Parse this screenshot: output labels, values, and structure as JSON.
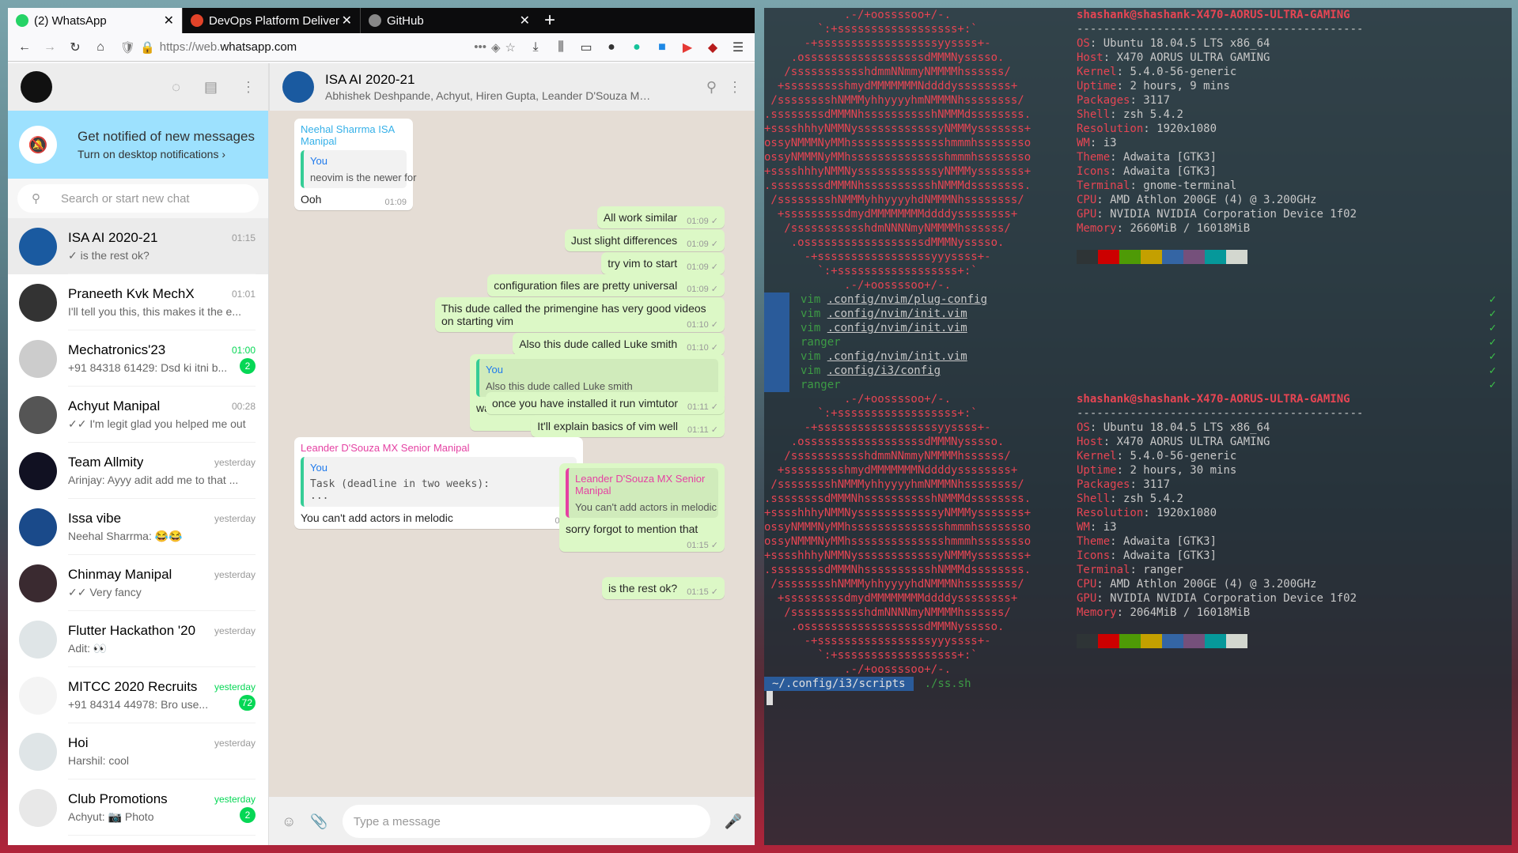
{
  "browser": {
    "tabs": [
      {
        "label": "(2) WhatsApp",
        "color": "#25d366"
      },
      {
        "label": "DevOps Platform Deliver",
        "color": "#e24329"
      },
      {
        "label": "GitHub",
        "color": "#888888"
      }
    ],
    "url_prefix": "https://web.",
    "url_domain": "whatsapp.com"
  },
  "whatsapp": {
    "notif_title": "Get notified of new messages",
    "notif_sub": "Turn on desktop notifications ›",
    "search_placeholder": "Search or start new chat",
    "chats": [
      {
        "name": "ISA AI 2020-21",
        "time": "01:15",
        "preview": "✓ is the rest ok?",
        "badge": "",
        "color": "#1a5aa0"
      },
      {
        "name": "Praneeth Kvk MechX",
        "time": "01:01",
        "preview": "I'll tell you this, this makes it the e...",
        "badge": "",
        "color": "#333333"
      },
      {
        "name": "Mechatronics'23",
        "time": "01:00",
        "preview": "+91 84318 61429: Dsd ki itni b...",
        "badge": "2",
        "color": "#cccccc"
      },
      {
        "name": "Achyut Manipal",
        "time": "00:28",
        "preview": "✓✓ I'm legit glad you helped me out",
        "badge": "",
        "color": "#555555"
      },
      {
        "name": "Team Allmity",
        "time": "yesterday",
        "preview": "Arinjay: Ayyy adit add me to that ...",
        "badge": "",
        "color": "#111122"
      },
      {
        "name": "Issa vibe",
        "time": "yesterday",
        "preview": "Neehal Sharrma: 😂😂",
        "badge": "",
        "color": "#1a4a8a"
      },
      {
        "name": "Chinmay Manipal",
        "time": "yesterday",
        "preview": "✓✓ Very fancy",
        "badge": "",
        "color": "#3a2a30"
      },
      {
        "name": "Flutter Hackathon '20",
        "time": "yesterday",
        "preview": "Adit: 👀",
        "badge": "",
        "color": "#dfe5e7"
      },
      {
        "name": "MITCC 2020 Recruits",
        "time": "yesterday",
        "preview": "+91 84314 44978: Bro use...",
        "badge": "72",
        "color": "#f4f4f4"
      },
      {
        "name": "Hoi",
        "time": "yesterday",
        "preview": "Harshil: cool",
        "badge": "",
        "color": "#dfe5e7"
      },
      {
        "name": "Club Promotions",
        "time": "yesterday",
        "preview": "Achyut: 📷 Photo",
        "badge": "2",
        "color": "#e8e8e8"
      }
    ],
    "group_name": "ISA AI 2020-21",
    "group_members": "Abhishek Deshpande, Achyut, Hiren Gupta, Leander D'Souza MX, Mi...",
    "compose_placeholder": "Type a message",
    "messages": [
      {
        "dir": "in",
        "sender": "Neehal Sharrma ISA Manipal",
        "quote_author": "You",
        "quote": "neovim is the newer for",
        "text": "Ooh",
        "time": "01:09"
      },
      {
        "dir": "out",
        "text": "All work similar",
        "time": "01:09 ✓"
      },
      {
        "dir": "out",
        "text": "Just slight differences",
        "time": "01:09 ✓"
      },
      {
        "dir": "out",
        "text": "try vim to start",
        "time": "01:09 ✓"
      },
      {
        "dir": "out",
        "text": "configuration files are pretty universal",
        "time": "01:09 ✓"
      },
      {
        "dir": "out",
        "text": "This dude called the primengine has very good videos on starting vim",
        "time": "01:10 ✓"
      },
      {
        "dir": "out",
        "text": "Also this dude called Luke smith",
        "time": "01:10 ✓"
      },
      {
        "dir": "out",
        "quote_author": "You",
        "quote": "Also this dude called Luke smith",
        "text": "watch his vimtutor playthrough for a crash course",
        "time": "01:10 ✓"
      },
      {
        "dir": "out",
        "text": "once you have installed it run vimtutor",
        "time": "01:11 ✓"
      },
      {
        "dir": "out",
        "text": "It'll explain basics of vim well",
        "time": "01:11 ✓"
      },
      {
        "dir": "in",
        "sender": "Leander D'Souza MX Senior Manipal",
        "quote_author": "You",
        "quote": "Task (deadline in two weeks):\n...",
        "text": "You can't add actors in melodic",
        "time": "01:15"
      },
      {
        "dir": "out",
        "quote_author": "Leander D'Souza MX Senior Manipal",
        "quote": "You can't add actors in melodic",
        "text": "sorry forgot to mention that",
        "time": "01:15 ✓"
      },
      {
        "dir": "out",
        "text": "is the rest ok?",
        "time": "01:15 ✓"
      }
    ]
  },
  "terminal": {
    "user": "shashank@shashank-X470-AORUS-ULTRA-GAMING",
    "sep": "-------------------------------------------",
    "info1": [
      [
        "OS",
        "Ubuntu 18.04.5 LTS x86_64"
      ],
      [
        "Host",
        "X470 AORUS ULTRA GAMING"
      ],
      [
        "Kernel",
        "5.4.0-56-generic"
      ],
      [
        "Uptime",
        "2 hours, 9 mins"
      ],
      [
        "Packages",
        "3117"
      ],
      [
        "Shell",
        "zsh 5.4.2"
      ],
      [
        "Resolution",
        "1920x1080"
      ],
      [
        "WM",
        "i3"
      ],
      [
        "Theme",
        "Adwaita [GTK3]"
      ],
      [
        "Icons",
        "Adwaita [GTK3]"
      ],
      [
        "Terminal",
        "gnome-terminal"
      ],
      [
        "CPU",
        "AMD Athlon 200GE (4) @ 3.200GHz"
      ],
      [
        "GPU",
        "NVIDIA NVIDIA Corporation Device 1f02"
      ],
      [
        "Memory",
        "2660MiB / 16018MiB"
      ]
    ],
    "info2": [
      [
        "OS",
        "Ubuntu 18.04.5 LTS x86_64"
      ],
      [
        "Host",
        "X470 AORUS ULTRA GAMING"
      ],
      [
        "Kernel",
        "5.4.0-56-generic"
      ],
      [
        "Uptime",
        "2 hours, 30 mins"
      ],
      [
        "Packages",
        "3117"
      ],
      [
        "Shell",
        "zsh 5.4.2"
      ],
      [
        "Resolution",
        "1920x1080"
      ],
      [
        "WM",
        "i3"
      ],
      [
        "Theme",
        "Adwaita [GTK3]"
      ],
      [
        "Icons",
        "Adwaita [GTK3]"
      ],
      [
        "Terminal",
        "ranger"
      ],
      [
        "CPU",
        "AMD Athlon 200GE (4) @ 3.200GHz"
      ],
      [
        "GPU",
        "NVIDIA NVIDIA Corporation Device 1f02"
      ],
      [
        "Memory",
        "2064MiB / 16018MiB"
      ]
    ],
    "history": [
      [
        "vim",
        ".config/nvim/plug-config"
      ],
      [
        "vim",
        ".config/nvim/init.vim"
      ],
      [
        "vim",
        ".config/nvim/init.vim"
      ],
      [
        "ranger",
        ""
      ],
      [
        "vim",
        ".config/nvim/init.vim"
      ],
      [
        "vim",
        ".config/i3/config"
      ],
      [
        "ranger",
        ""
      ]
    ],
    "prompt_dir": "~/.config/i3/scripts",
    "prompt_cmd": "./ss.sh",
    "palette": [
      "#2e3436",
      "#cc0000",
      "#4e9a06",
      "#c4a000",
      "#3465a4",
      "#75507b",
      "#06989a",
      "#d3d7cf"
    ]
  }
}
